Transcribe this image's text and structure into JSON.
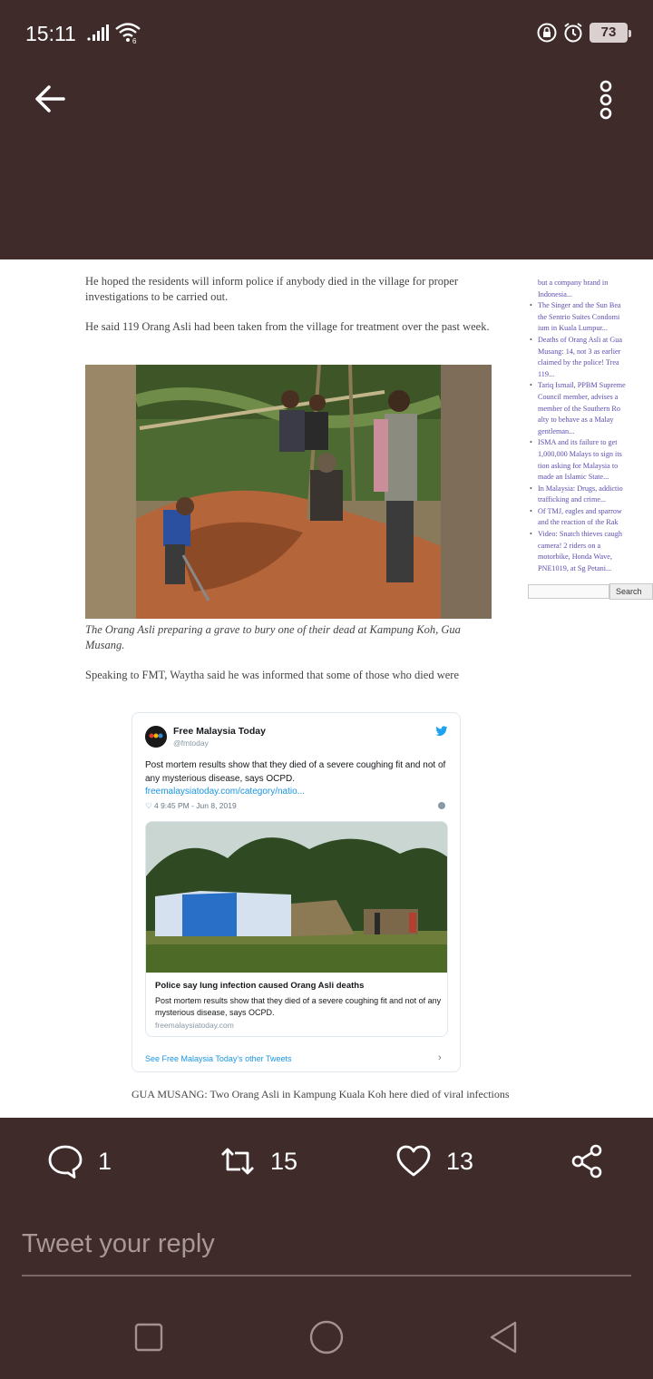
{
  "status_bar": {
    "time": "15:11",
    "battery": "73"
  },
  "article": {
    "paragraph_1": "He hoped the residents will inform police if anybody died in the village for proper investigations to be carried out.",
    "paragraph_2": "He said 119 Orang Asli had been taken from the village for treatment over the past week.",
    "caption": "The Orang Asli preparing a grave to bury one of their dead at Kampung Koh, Gua Musang.",
    "paragraph_3": "Speaking to FMT, Waytha said he was informed that some of those who died were",
    "footer_line": "GUA MUSANG: Two Orang Asli in Kampung Kuala Koh here died of viral infections"
  },
  "sidebar": {
    "lines": [
      "but a company brand in",
      "Indonesia...",
      "The Singer and the Sun Bea",
      "the Sentrio Suites Condomi",
      "ium in Kuala Lumpur...",
      "Deaths of Orang Asli at Gua",
      "Musang: 14, not 3 as earlier",
      "claimed by the police! Trea",
      "119...",
      "Tariq Ismail, PPBM Supreme",
      "Council member, advises a",
      "member of the Southern Ro",
      "alty to behave as a Malay",
      "gentleman...",
      "ISMA and its failure to get",
      "1,000,000 Malays to sign its",
      "tion asking for Malaysia to",
      "made an Islamic State...",
      "In Malaysia: Drugs, addictio",
      "trafficking and crime...",
      "Of TMJ, eagles and sparrow",
      "and the reaction of the Rak",
      "Video: Snatch thieves caugh",
      "camera! 2 riders on a",
      "motorbike, Honda Wave,",
      "PNE1019, at Sg Petani..."
    ],
    "search_button": "Search"
  },
  "embedded_tweet": {
    "name": "Free Malaysia Today",
    "handle": "@fmtoday",
    "text": "Post mortem results show that they died of a severe coughing fit and not of any mysterious disease, says OCPD.",
    "link": "freemalaysiatoday.com/category/natio...",
    "meta": "♡ 4   9:45 PM - Jun 8, 2019",
    "card_title": "Police say lung infection caused Orang Asli deaths",
    "card_desc": "Post mortem results show that they died of a severe coughing fit and not of any mysterious disease, says OCPD.",
    "card_domain": "freemalaysiatoday.com",
    "footer": "See Free Malaysia Today's other Tweets"
  },
  "actions": {
    "replies": "1",
    "retweets": "15",
    "likes": "13"
  },
  "reply_box": {
    "placeholder": "Tweet your reply"
  },
  "colors": {
    "background": "#3e2b2a",
    "text": "#ffffff",
    "placeholder": "#a99896"
  }
}
